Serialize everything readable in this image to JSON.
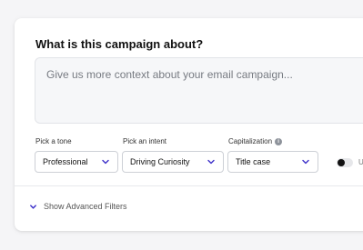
{
  "form": {
    "title": "What is this campaign about?",
    "context_placeholder": "Give us more context about your email campaign...",
    "tone": {
      "label": "Pick a tone",
      "value": "Professional"
    },
    "intent": {
      "label": "Pick an intent",
      "value": "Driving Curiosity"
    },
    "capitalization": {
      "label": "Capitalization",
      "info_glyph": "i",
      "value": "Title case"
    },
    "toggle": {
      "label": "U",
      "on": false
    },
    "advanced_filters_label": "Show Advanced Filters"
  },
  "colors": {
    "accent": "#3b2fc9",
    "muted_text": "#777b82"
  },
  "icons": [
    "chevron-down-icon",
    "info-icon",
    "toggle-switch"
  ]
}
